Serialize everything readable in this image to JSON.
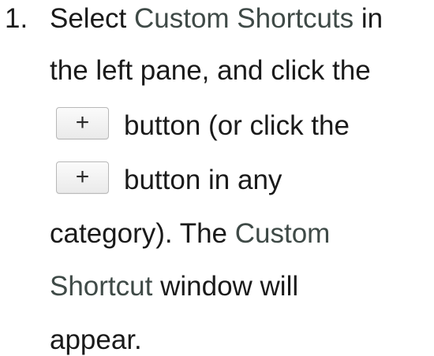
{
  "step": {
    "number": "1.",
    "line1": {
      "pre": "Select ",
      "ref": "Custom Shortcuts",
      "post": " in"
    },
    "line2": {
      "text": "the left pane, and click the"
    },
    "line3": {
      "button_label": "+",
      "post": "button (or click the"
    },
    "line4": {
      "button_label": "+",
      "post": "button in any"
    },
    "line5": {
      "pre": "category). The ",
      "ref": "Custom"
    },
    "line6": {
      "ref": "Shortcut",
      "post": " window will"
    },
    "line7": {
      "text": "appear."
    }
  }
}
